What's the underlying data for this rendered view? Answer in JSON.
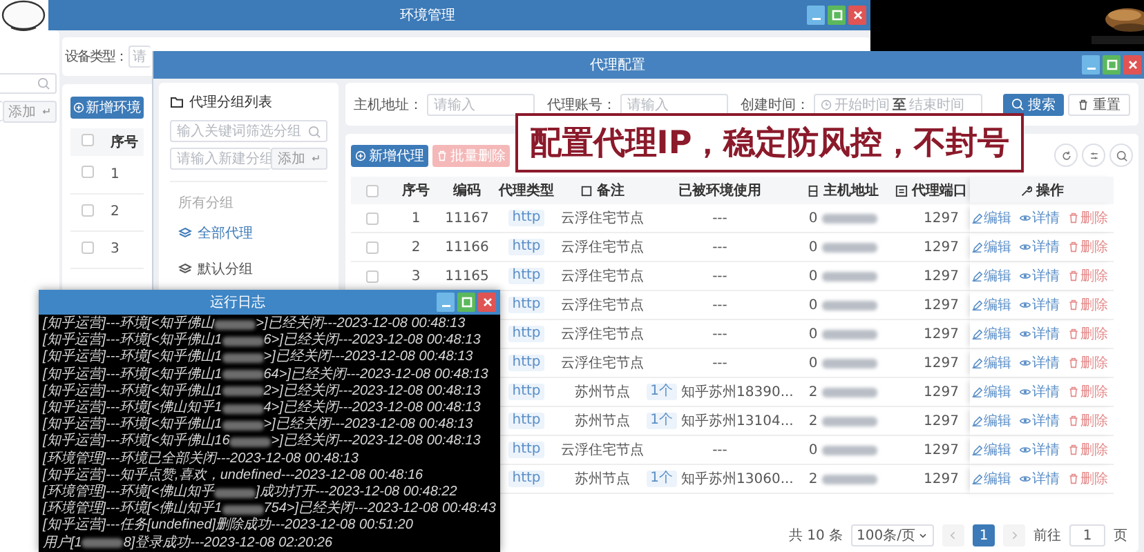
{
  "env_window": {
    "title": "环境管理",
    "group_add_button": "添加",
    "filter": {
      "label": "设备类型：",
      "placeholder": "请"
    },
    "add_button": "新增环境",
    "select_all_checked": false,
    "columns": [
      "序号"
    ],
    "rows": [
      {
        "index": "1",
        "checked": false
      },
      {
        "index": "2",
        "checked": false
      },
      {
        "index": "3",
        "checked": false
      }
    ]
  },
  "proxy_window": {
    "title": "代理配置",
    "groups": {
      "title": "代理分组列表",
      "search_placeholder": "输入关键词筛选分组",
      "new_placeholder": "请输入新建分组",
      "add_button": "添加",
      "section": "所有分组",
      "items": [
        {
          "label": "全部代理",
          "selected": true
        },
        {
          "label": "默认分组",
          "selected": false
        }
      ]
    },
    "filters": [
      {
        "label": "主机地址：",
        "placeholder": "请输入"
      },
      {
        "label": "代理账号：",
        "placeholder": "请输入"
      }
    ],
    "date_filter": {
      "label": "创建时间：",
      "start_placeholder": "开始时间",
      "separator": "至",
      "end_placeholder": "结束时间"
    },
    "search_button": "搜索",
    "reset_button": "重置",
    "add_button": "新增代理",
    "batch_delete_button": {
      "label": "批量删除",
      "disabled": true
    },
    "banner": "配置代理IP，稳定防风控，不封号",
    "select_all_checked": false,
    "columns": [
      {
        "label": "序号",
        "kind": "plain"
      },
      {
        "label": "编码",
        "kind": "plain"
      },
      {
        "label": "代理类型",
        "kind": "plain"
      },
      {
        "label": "备注",
        "kind": "note"
      },
      {
        "label": "已被环境使用",
        "kind": "plain"
      },
      {
        "label": "主机地址",
        "kind": "host"
      },
      {
        "label": "代理端口",
        "kind": "port"
      },
      {
        "label": "操作",
        "kind": "wrench"
      }
    ],
    "rows": [
      {
        "index": "1",
        "checked": false,
        "code": "11167",
        "type": "http",
        "remark": "云浮住宅节点",
        "used_by": "---",
        "host": "0",
        "port": "1297",
        "actions": [
          "编辑",
          "详情",
          "删除"
        ]
      },
      {
        "index": "2",
        "checked": false,
        "code": "11166",
        "type": "http",
        "remark": "云浮住宅节点",
        "used_by": "---",
        "host": "0",
        "port": "1297",
        "actions": [
          "编辑",
          "详情",
          "删除"
        ]
      },
      {
        "index": "3",
        "checked": false,
        "code": "11165",
        "type": "http",
        "remark": "云浮住宅节点",
        "used_by": "---",
        "host": "0",
        "port": "1297",
        "actions": [
          "编辑",
          "详情",
          "删除"
        ]
      },
      {
        "type": "http",
        "remark": "云浮住宅节点",
        "used_by": "---",
        "host": "0",
        "port": "1297",
        "actions": [
          "编辑",
          "详情",
          "删除"
        ]
      },
      {
        "type": "http",
        "remark": "云浮住宅节点",
        "used_by": "---",
        "host": "0",
        "port": "1297",
        "actions": [
          "编辑",
          "详情",
          "删除"
        ]
      },
      {
        "type": "http",
        "remark": "云浮住宅节点",
        "used_by": "---",
        "host": "0",
        "port": "1297",
        "actions": [
          "编辑",
          "详情",
          "删除"
        ]
      },
      {
        "type": "http",
        "remark": "苏州节点",
        "used_count": "1个",
        "used_by": "知乎苏州18390...",
        "host": "2",
        "port": "1297",
        "actions": [
          "编辑",
          "详情",
          "删除"
        ]
      },
      {
        "type": "http",
        "remark": "苏州节点",
        "used_count": "1个",
        "used_by": "知乎苏州13104...",
        "host": "2",
        "port": "1297",
        "actions": [
          "编辑",
          "详情",
          "删除"
        ]
      },
      {
        "type": "http",
        "remark": "云浮住宅节点",
        "used_by": "---",
        "host": "0",
        "port": "1297",
        "actions": [
          "编辑",
          "详情",
          "删除"
        ]
      },
      {
        "type": "http",
        "remark": "苏州节点",
        "used_count": "1个",
        "used_by": "知乎苏州13060...",
        "host": "2",
        "port": "1297",
        "actions": [
          "编辑",
          "详情",
          "删除"
        ]
      }
    ],
    "pagination": {
      "total": "共 10 条",
      "page_size": "100条/页",
      "pages": [
        {
          "label": "1",
          "selected": true
        }
      ],
      "goto_label": "前往",
      "goto_value": "1",
      "page_suffix": "页"
    }
  },
  "log_window": {
    "title": "运行日志",
    "lines": [
      {
        "parts": [
          "[知乎运营]---环境[<知乎佛山",
          ">]已经关闭---2023-12-08 00:48:13"
        ]
      },
      {
        "parts": [
          "[知乎运营]---环境[<知乎佛山1",
          "6>]已经关闭---2023-12-08 00:48:13"
        ]
      },
      {
        "parts": [
          "[知乎运营]---环境[<知乎佛山1",
          ">]已经关闭---2023-12-08 00:48:13"
        ]
      },
      {
        "parts": [
          "[知乎运营]---环境[<知乎佛山1",
          "64>]已经关闭---2023-12-08 00:48:13"
        ]
      },
      {
        "parts": [
          "[知乎运营]---环境[<知乎佛山1",
          "2>]已经关闭---2023-12-08 00:48:13"
        ]
      },
      {
        "parts": [
          "[知乎运营]---环境[<佛山知乎1",
          "4>]已经关闭---2023-12-08 00:48:13"
        ]
      },
      {
        "parts": [
          "[知乎运营]---环境[<知乎佛山1",
          ">]已经关闭---2023-12-08 00:48:13"
        ]
      },
      {
        "parts": [
          "[知乎运营]---环境[<知乎佛山16",
          ">]已经关闭---2023-12-08 00:48:13"
        ]
      },
      {
        "parts": [
          "[环境管理]---环境已全部关闭---2023-12-08 00:48:13"
        ]
      },
      {
        "parts": [
          "[知乎运营]---知乎点赞,喜欢，undefined---2023-12-08 00:48:16"
        ]
      },
      {
        "parts": [
          "[环境管理]---环境[<佛山知乎",
          "]成功打开---2023-12-08 00:48:22"
        ]
      },
      {
        "parts": [
          "[环境管理]---环境[<佛山知乎1",
          "754>]已经关闭---2023-12-08 00:48:43"
        ]
      },
      {
        "parts": [
          "[知乎运营]---任务[undefined]删除成功---2023-12-08 00:51:20"
        ]
      },
      {
        "parts": [
          "用户[1",
          "8]登录成功---2023-12-08 02:20:26"
        ]
      }
    ]
  }
}
